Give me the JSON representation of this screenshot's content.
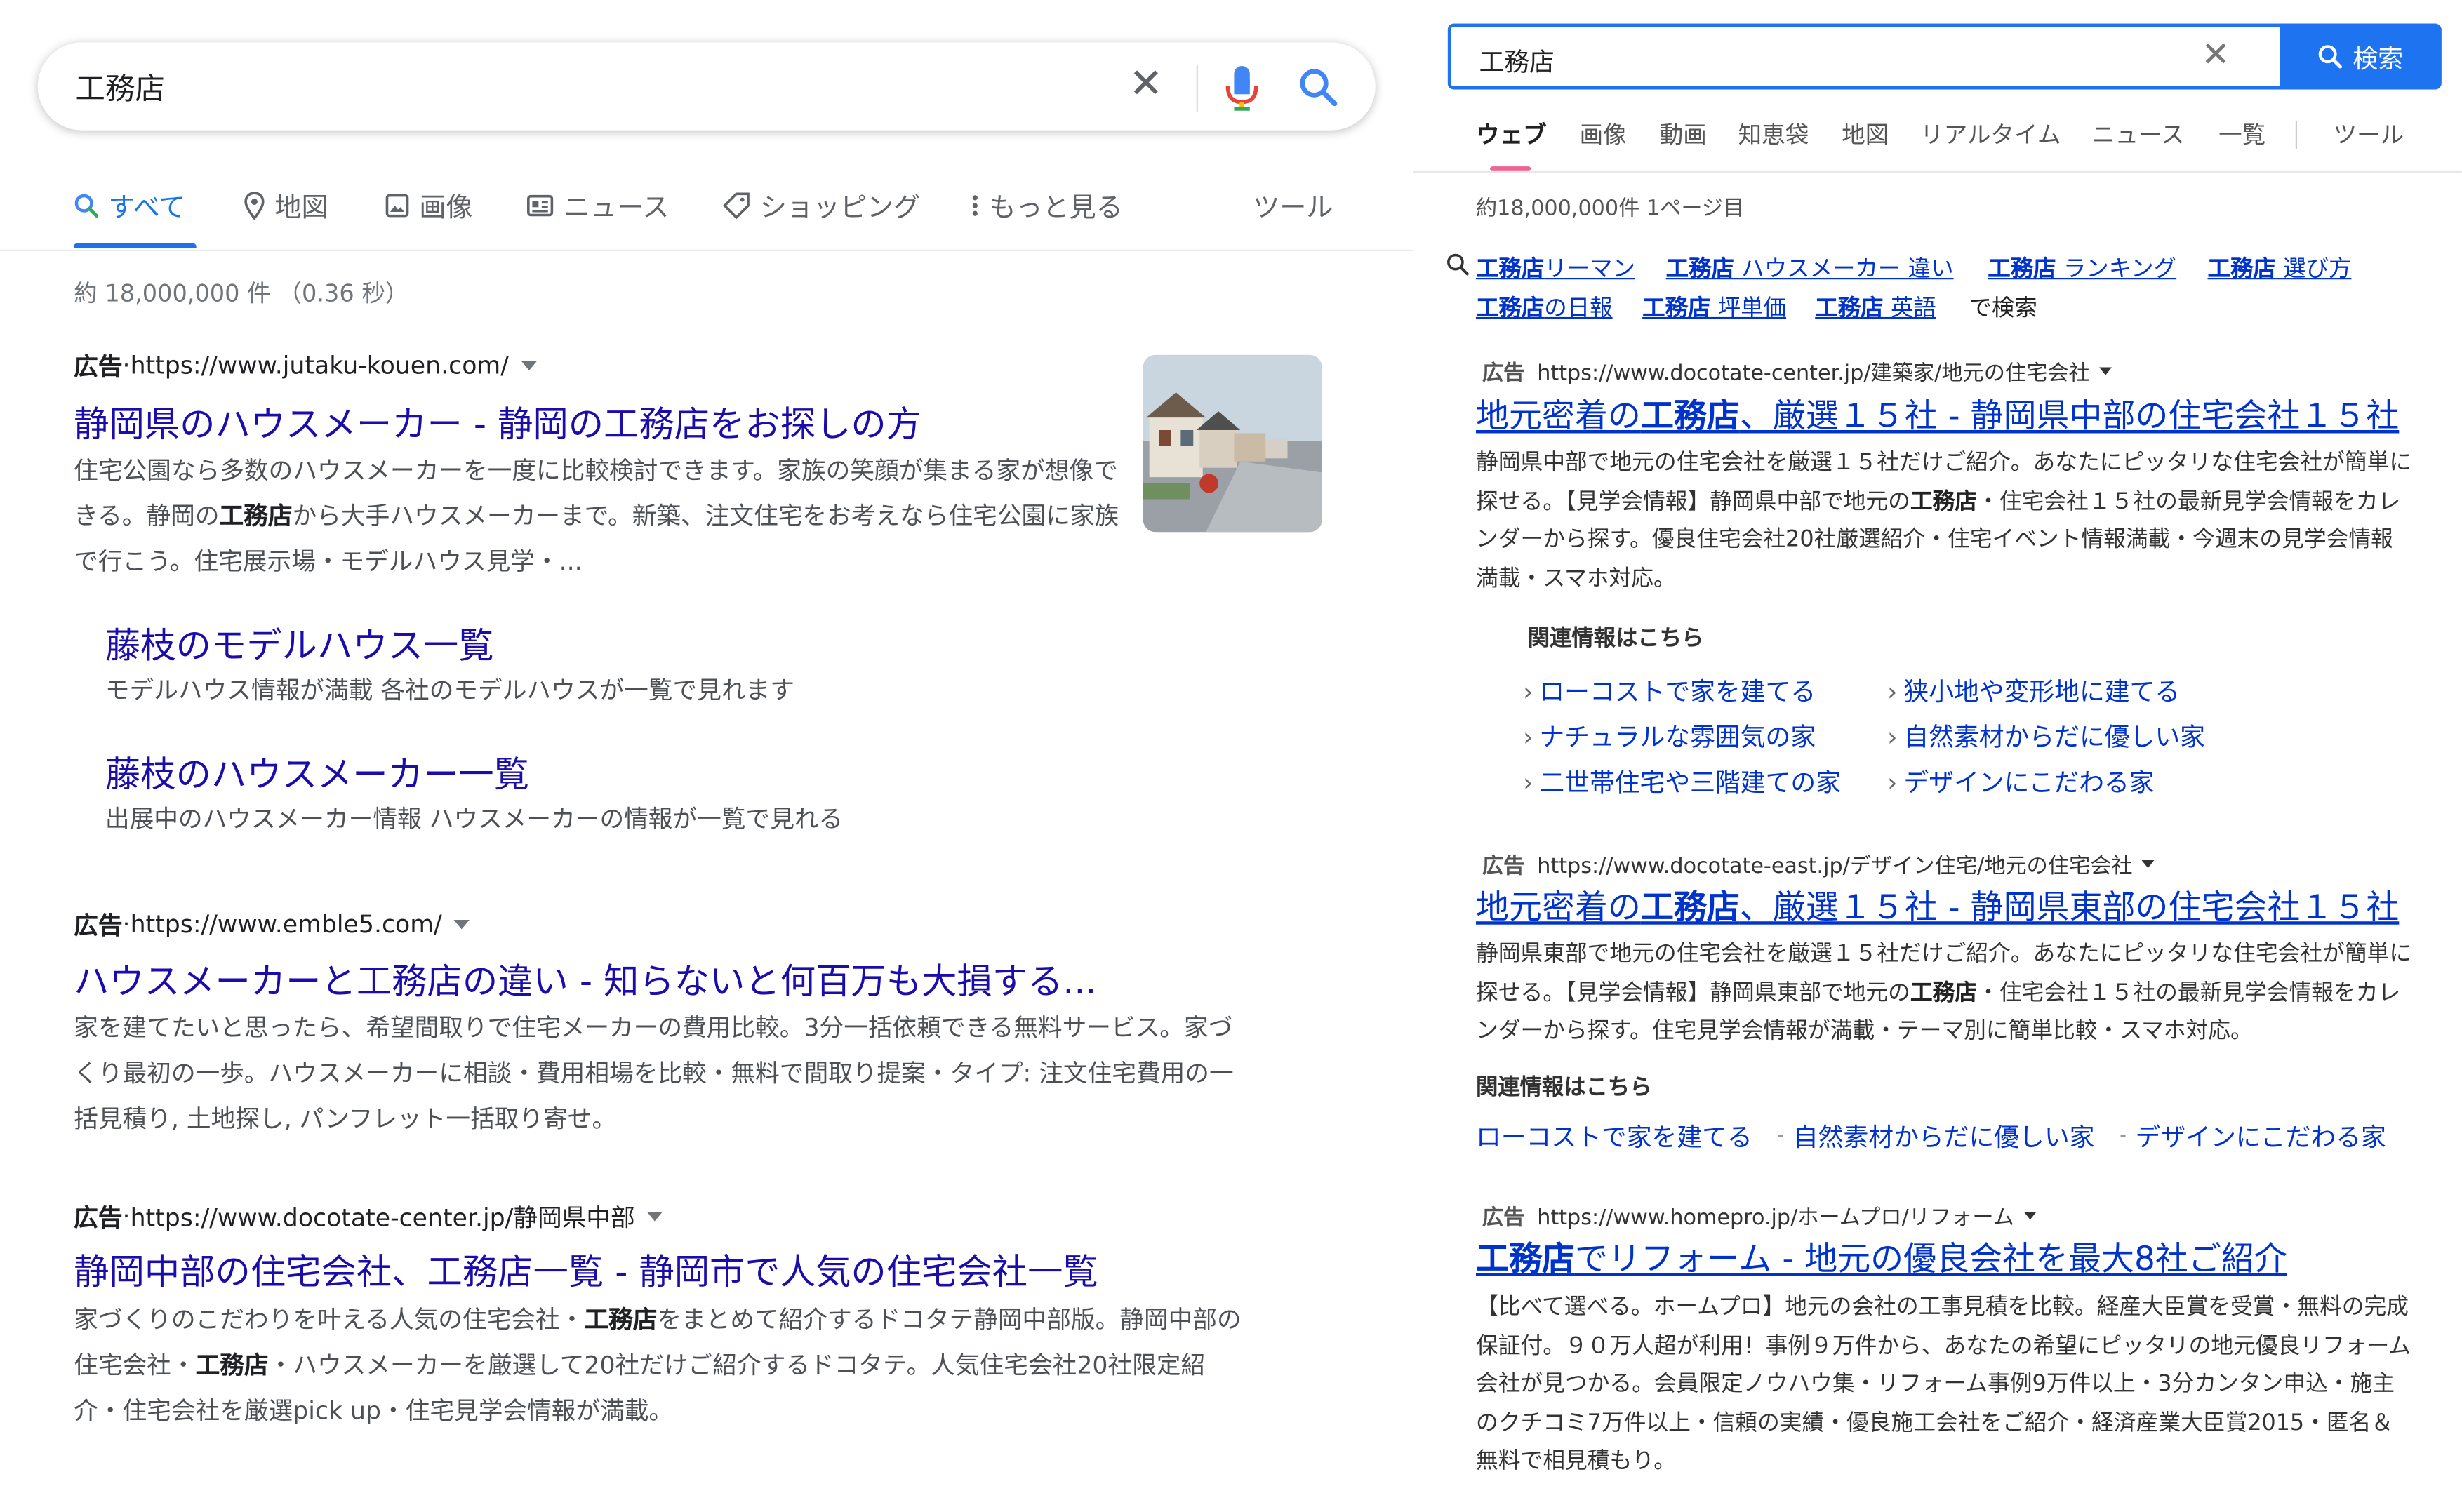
{
  "google": {
    "search": {
      "query": "工務店"
    },
    "tabs": [
      {
        "label": "すべて",
        "icon": "search-icon",
        "active": true
      },
      {
        "label": "地図",
        "icon": "map-pin-icon"
      },
      {
        "label": "画像",
        "icon": "image-icon"
      },
      {
        "label": "ニュース",
        "icon": "news-icon"
      },
      {
        "label": "ショッピング",
        "icon": "tag-icon"
      },
      {
        "label": "もっと見る",
        "icon": "more-vert-icon"
      },
      {
        "label": "ツール"
      }
    ],
    "stats": "約 18,000,000 件 （0.36 秒）",
    "results": [
      {
        "ad_label": "広告",
        "sep": " · ",
        "url": "https://www.jutaku-kouen.com/",
        "title": "静岡県のハウスメーカー - 静岡の工務店をお探しの方",
        "desc_a": "住宅公園なら多数のハウスメーカーを一度に比較検討できます。家族の笑顔が集まる家が想像できる。静岡の",
        "desc_b": "工務店",
        "desc_c": "から大手ハウスメーカーまで。新築、注文住宅をお考えなら住宅公園に家族で行こう。住宅展示場・モデルハウス見学・...",
        "sitelinks": [
          {
            "title": "藤枝のモデルハウス一覧",
            "desc": "モデルハウス情報が満載 各社のモデルハウスが一覧で見れます"
          },
          {
            "title": "藤枝のハウスメーカー一覧",
            "desc": "出展中のハウスメーカー情報 ハウスメーカーの情報が一覧で見れる"
          }
        ]
      },
      {
        "ad_label": "広告",
        "sep": " · ",
        "url": "https://www.emble5.com/",
        "title": "ハウスメーカーと工務店の違い - 知らないと何百万も大損する...",
        "desc": "家を建てたいと思ったら、希望間取りで住宅メーカーの費用比較。3分一括依頼できる無料サービス。家づくり最初の一歩。ハウスメーカーに相談・費用相場を比較・無料で間取り提案・タイプ: 注文住宅費用の一括見積り, 土地探し, パンフレット一括取り寄せ。"
      },
      {
        "ad_label": "広告",
        "sep": " · ",
        "url": "https://www.docotate-center.jp/静岡県中部",
        "title": "静岡中部の住宅会社、工務店一覧 - 静岡市で人気の住宅会社一覧",
        "desc_a": "家づくりのこだわりを叶える人気の住宅会社・",
        "desc_b": "工務店",
        "desc_c": "をまとめて紹介するドコタテ静岡中部版。静岡中部の住宅会社・",
        "desc_d": "工務店",
        "desc_e": "・ハウスメーカーを厳選して20社だけご紹介するドコタテ。人気住宅会社20社限定紹介・住宅会社を厳選pick up・住宅見学会情報が満載。"
      }
    ]
  },
  "yahoo": {
    "search": {
      "query": "工務店",
      "button_label": "検索"
    },
    "tabs": [
      "ウェブ",
      "画像",
      "動画",
      "知恵袋",
      "地図",
      "リアルタイム",
      "ニュース",
      "一覧",
      "ツール"
    ],
    "stats": "約18,000,000件 1ページ目",
    "related_searches": [
      {
        "bold": "工務店",
        "rest": "リーマン"
      },
      {
        "bold": "工務店",
        "rest": " ハウスメーカー 違い"
      },
      {
        "bold": "工務店",
        "rest": " ランキング"
      },
      {
        "bold": "工務店",
        "rest": " 選び方"
      },
      {
        "bold": "工務店",
        "rest": "の日報"
      },
      {
        "bold": "工務店",
        "rest": " 坪単価"
      },
      {
        "bold": "工務店",
        "rest": " 英語"
      }
    ],
    "related_suffix": "で検索",
    "results": [
      {
        "ad_label": "広告",
        "url": "https://www.docotate-center.jp/建築家/地元の住宅会社",
        "title_a": "地元密着の",
        "title_b": "工務店",
        "title_c": "、厳選１５社 - 静岡県中部の住宅会社１５社",
        "desc_a": "静岡県中部で地元の住宅会社を厳選１５社だけご紹介。あなたにピッタリな住宅会社が簡単に探せる。【見学会情報】静岡県中部で地元の",
        "desc_b": "工務店",
        "desc_c": "・住宅会社１５社の最新見学会情報をカレンダーから探す。優良住宅会社20社厳選紹介・住宅イベント情報満載・今週末の見学会情報満載・スマホ対応。",
        "related_head": "関連情報はこちら",
        "sitelinks": [
          "ローコストで家を建てる",
          "狭小地や変形地に建てる",
          "ナチュラルな雰囲気の家",
          "自然素材からだに優しい家",
          "二世帯住宅や三階建ての家",
          "デザインにこだわる家"
        ]
      },
      {
        "ad_label": "広告",
        "url": "https://www.docotate-east.jp/デザイン住宅/地元の住宅会社",
        "title_a": "地元密着の",
        "title_b": "工務店",
        "title_c": "、厳選１５社 - 静岡県東部の住宅会社１５社",
        "desc_a": "静岡県東部で地元の住宅会社を厳選１５社だけご紹介。あなたにピッタリな住宅会社が簡単に探せる。【見学会情報】静岡県東部で地元の",
        "desc_b": "工務店",
        "desc_c": "・住宅会社１５社の最新見学会情報をカレンダーから探す。住宅見学会情報が満載・テーマ別に簡単比較・スマホ対応。",
        "related_head": "関連情報はこちら",
        "sitelinks": [
          "ローコストで家を建てる",
          "自然素材からだに優しい家",
          "デザインにこだわる家"
        ]
      },
      {
        "ad_label": "広告",
        "url": "https://www.homepro.jp/ホームプロ/リフォーム",
        "title_a": "",
        "title_b": "工務店",
        "title_c": "でリフォーム - 地元の優良会社を最大8社ご紹介",
        "desc": "【比べて選べる。ホームプロ】地元の会社の工事見積を比較。経産大臣賞を受賞・無料の完成保証付。９０万人超が利用！事例９万件から、あなたの希望にピッタリの地元優良リフォーム会社が見つかる。会員限定ノウハウ集・リフォーム事例9万件以上・3分カンタン申込・施主のクチコミ7万件以上・信頼の実績・優良施工会社をご紹介・経済産業大臣賞2015・匿名＆無料で相見積もり。"
      }
    ]
  },
  "colors": {
    "google_link": "#1a0dab",
    "google_blue": "#1a73e8",
    "yahoo_link": "#0033cc",
    "yahoo_blue": "#1e73f0",
    "yahoo_tab_accent": "#f06292"
  }
}
